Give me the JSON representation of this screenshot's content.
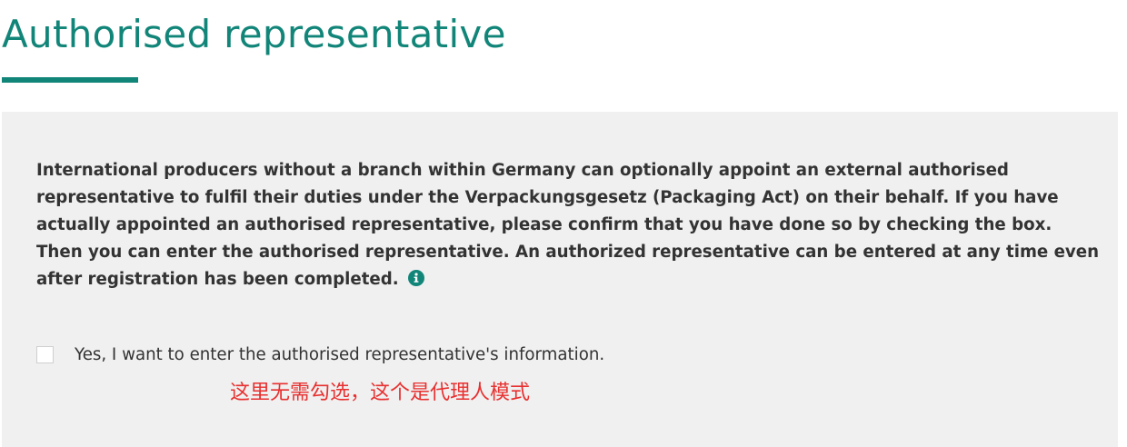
{
  "page": {
    "title": "Authorised representative"
  },
  "panel": {
    "description": "International producers without a branch within Germany can optionally appoint an external authorised representative to fulfil their duties under the Verpackungsgesetz (Packaging Act) on their behalf. If you have actually appointed an authorised representative, please confirm that you have done so by checking the box. Then you can enter the authorised representative. An authorized representative can be entered at any time even after registration has been completed.",
    "info_icon": "info-circle-icon",
    "checkbox": {
      "label": "Yes, I want to enter the authorised representative's information.",
      "checked": false
    },
    "annotation": "这里无需勾选，这个是代理人模式"
  },
  "colors": {
    "accent": "#128579",
    "panel_background": "#f0f0f0",
    "text": "#333333",
    "annotation": "#e83030"
  }
}
